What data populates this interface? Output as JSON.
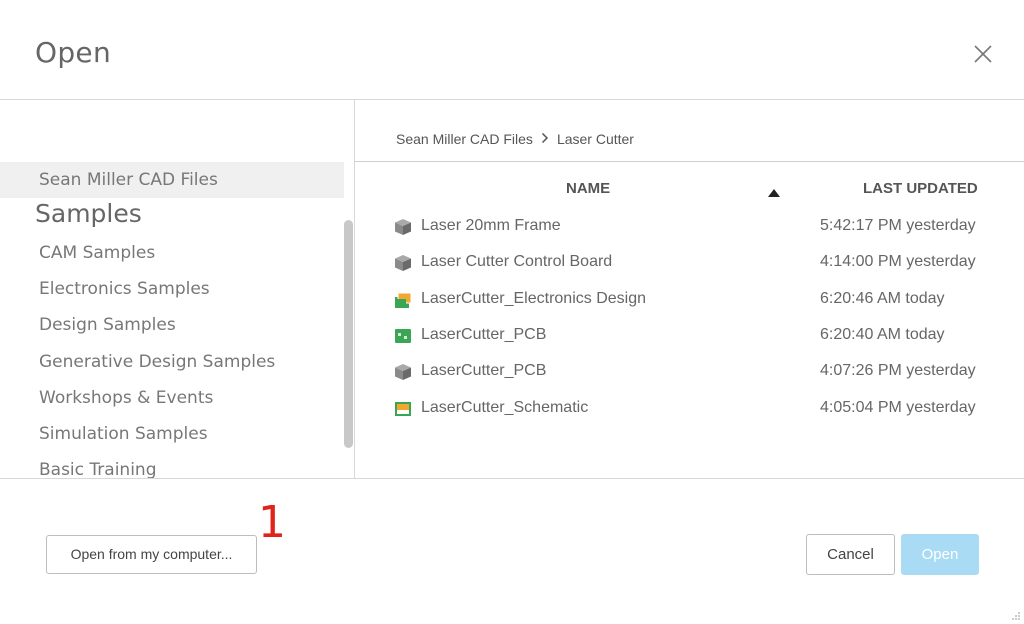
{
  "dialog": {
    "title": "Open",
    "close_icon": "close-icon"
  },
  "sidebar": {
    "selected_project": "Sean Miller CAD Files",
    "section_heading": "Samples",
    "items": [
      "CAM Samples",
      "Electronics Samples",
      "Design Samples",
      "Generative Design Samples",
      "Workshops & Events",
      "Simulation Samples",
      "Basic Training"
    ]
  },
  "breadcrumb": {
    "root": "Sean Miller CAD Files",
    "current": "Laser Cutter"
  },
  "table": {
    "col_name": "NAME",
    "col_updated": "LAST UPDATED",
    "sort": "ascending",
    "rows": [
      {
        "name": "Laser 20mm Frame",
        "updated": "5:42:17 PM yesterday",
        "icon": "design-3d-icon"
      },
      {
        "name": "Laser Cutter Control Board",
        "updated": "4:14:00 PM yesterday",
        "icon": "design-3d-icon"
      },
      {
        "name": "LaserCutter_Electronics Design",
        "updated": "6:20:46 AM today",
        "icon": "electronics-design-icon"
      },
      {
        "name": "LaserCutter_PCB",
        "updated": "6:20:40 AM today",
        "icon": "pcb-icon"
      },
      {
        "name": "LaserCutter_PCB",
        "updated": "4:07:26 PM yesterday",
        "icon": "design-3d-icon"
      },
      {
        "name": "LaserCutter_Schematic",
        "updated": "4:05:04 PM yesterday",
        "icon": "schematic-icon"
      }
    ]
  },
  "footer": {
    "open_from_computer": "Open from my computer...",
    "cancel": "Cancel",
    "open": "Open",
    "annotation": "1"
  },
  "colors": {
    "open_button_bg": "#a9dcf4",
    "annotation": "#e0231b",
    "icon_gray": "#7a7a7a",
    "icon_green": "#3aa655",
    "icon_orange": "#f0a830"
  }
}
